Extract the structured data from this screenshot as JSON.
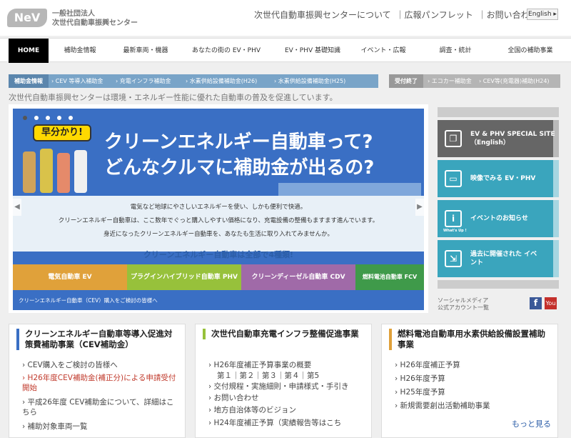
{
  "header": {
    "logo_text": "NeV",
    "org_line1": "一般社団法人",
    "org_line2": "次世代自動車振興センター",
    "links": [
      "次世代自動車振興センターについて",
      "｜広報パンフレット",
      "｜お問い合わせ"
    ],
    "lang": "English ▸"
  },
  "nav": [
    "HOME",
    "補助金情報",
    "最新車両・機器",
    "あなたの街の EV・PHV",
    "EV・PHV 基礎知識",
    "イベント・広報",
    "調査・統計",
    "全国の補助事業"
  ],
  "subnav": {
    "active_label": "補助金情報",
    "items": [
      "CEV 等導入補助金",
      "充電インフラ補助金",
      "水素供給設備補助金(H26)",
      "水素供給設備補助金(H25)"
    ],
    "closed_label": "受付終了",
    "closed_items": [
      "エコカー補助金",
      "CEV等(充電器)補助(H24)"
    ]
  },
  "intro": "次世代自動車振興センターは環境・エネルギー性能に優れた自動車の普及を促進しています。",
  "hero": {
    "badge": "早分かり!",
    "title1": "クリーンエネルギー自動車って?",
    "title2": "どんなクルマに補助金が出るの?",
    "body": [
      "電気など地球にやさしいエネルギーを使い、しかも便利で快適。",
      "クリーンエネルギー自動車は、ここ数年でぐっと購入しやすい価格になり、充電設備の整備もますます進んでいます。",
      "身近になったクリーンエネルギー自動車を、あなたも生活に取り入れてみませんか。"
    ],
    "subtitle": "クリーンエネルギー自動車は全部で4種類!",
    "cats": [
      "電気自動車 EV",
      "プラグインハイブリッド自動車 PHV",
      "クリーンディーゼル自動車 CDV",
      "燃料電池自動車 FCV"
    ],
    "footer": "クリーンエネルギー自動車（CEV）購入をご検討の皆様へ",
    "colors": {
      "ev": "#e0a13a",
      "phv": "#97c13b",
      "cdv": "#a06aa8",
      "fcv": "#3f9a4a"
    }
  },
  "side": [
    {
      "label": "EV & PHV SPECIAL SITE（English）",
      "icon": "copy-icon"
    },
    {
      "label": "映像でみる EV・PHV",
      "icon": "video-icon"
    },
    {
      "label": "イベントのお知らせ",
      "icon": "info-icon",
      "small": "What's Up !"
    },
    {
      "label": "過去に開催された イベント",
      "icon": "history-icon"
    }
  ],
  "social": {
    "line1": "ソーシャルメディア",
    "line2": "公式アカウント一覧",
    "fb": "f",
    "yt": "You"
  },
  "boxes": [
    {
      "title": "クリーンエネルギー自動車等導入促進対策費補助事業（CEV補助金）",
      "items": [
        "CEV購入をご検討の皆様へ",
        "H26年度CEV補助金(補正分)による申請受付開始",
        "平成26年度 CEV補助金について、詳細はこちら",
        "補助対象車両一覧"
      ],
      "accent": "#3a6fc4"
    },
    {
      "title": "次世代自動車充電インフラ整備促進事業",
      "items": [
        "H26年度補正予算事業の概要",
        "第１｜第２｜第３｜第４｜第5",
        "交付規程・実施細則・申請様式・手引き",
        "お問い合わせ",
        "地方自治体等のビジョン",
        "H24年度補正予算（実績報告等はこち"
      ],
      "accent": "#97c13b"
    },
    {
      "title": "燃料電池自動車用水素供給設備設置補助事業",
      "items": [
        "H26年度補正予算",
        "H26年度予算",
        "H25年度予算",
        "新規需要創出活動補助事業"
      ],
      "accent": "#e0a13a"
    }
  ],
  "more": "もっと見る"
}
